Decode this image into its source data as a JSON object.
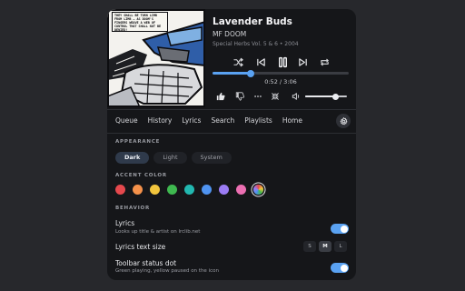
{
  "track": {
    "title": "Lavender Buds",
    "artist": "MF DOOM",
    "album_line": "Special Herbs Vol. 5 & 6 • 2004",
    "time_text": "0:52 / 3:06",
    "progress_fraction": 0.28,
    "volume_fraction": 0.72
  },
  "art": {
    "caption": "THEY SHALL BE TORN LIMB FROM LIMB — AS DOOM'S FINGERS WEAVE A WEB OF CONTROL THAT SHALL NOT BE DENIED!"
  },
  "transport": {
    "shuffle_icon": "shuffle-icon",
    "prev_icon": "skip-previous-icon",
    "pause_icon": "pause-icon",
    "next_icon": "skip-next-icon",
    "repeat_icon": "repeat-icon"
  },
  "actions": {
    "like_icon": "thumbs-up-icon",
    "dislike_icon": "thumbs-down-icon",
    "more_icon": "more-horizontal-icon",
    "collapse_icon": "collapse-icon",
    "volume_icon": "volume-icon"
  },
  "tabs": [
    "Queue",
    "History",
    "Lyrics",
    "Search",
    "Playlists",
    "Home"
  ],
  "settings_icon": "gear-icon",
  "appearance": {
    "heading": "APPEARANCE",
    "options": [
      "Dark",
      "Light",
      "System"
    ],
    "selected": "Dark"
  },
  "accent": {
    "heading": "ACCENT COLOR",
    "colors": [
      "#e5484d",
      "#f5914a",
      "#f2c53d",
      "#3fb950",
      "#22b8b0",
      "#4f93f0",
      "#9b7cf4",
      "#ec6fb2"
    ],
    "last_swatch": "multicolor"
  },
  "behavior": {
    "heading": "BEHAVIOR",
    "lyrics_label": "Lyrics",
    "lyrics_desc": "Looks up title & artist on lrclib.net",
    "lyrics_on": true,
    "lyrics_size_label": "Lyrics text size",
    "sizes": [
      "S",
      "M",
      "L"
    ],
    "size_selected": "M",
    "status_dot_label": "Toolbar status dot",
    "status_dot_desc": "Green playing, yellow paused on the icon",
    "status_dot_on": true
  },
  "colors": {
    "accent": "#5aa2f2",
    "panel_bg": "#151619",
    "page_bg": "#27282c"
  }
}
